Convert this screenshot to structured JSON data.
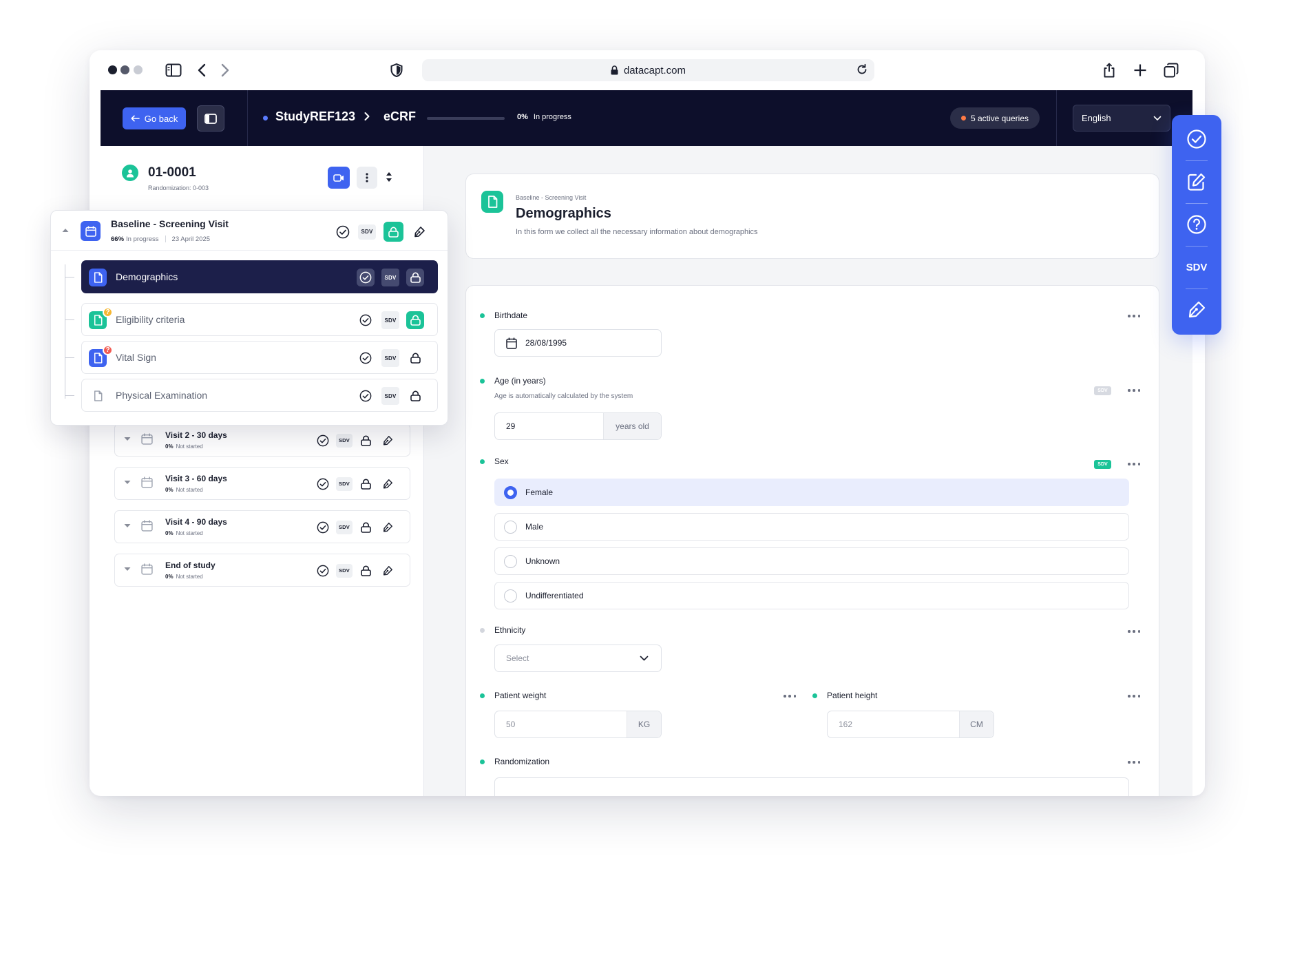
{
  "browser": {
    "url": "datacapt.com"
  },
  "topbar": {
    "back_label": "Go back",
    "study": "StudyREF123",
    "section": "eCRF",
    "progress_value": "0%",
    "progress_fraction": 0,
    "progress_status": "In progress",
    "queries": "5 active queries",
    "language": "English"
  },
  "patient": {
    "id": "01-0001",
    "randomization": "Randomization: 0-003"
  },
  "current_visit": {
    "title": "Baseline - Screening Visit",
    "progress": "66%",
    "status": "In progress",
    "date": "23 April 2025",
    "forms": [
      {
        "label": "Demographics",
        "sdv": "SDV"
      },
      {
        "label": "Eligibility criteria",
        "sdv": "SDV",
        "badge": "?"
      },
      {
        "label": "Vital Sign",
        "sdv": "SDV",
        "badge": "?"
      },
      {
        "label": "Physical Examination",
        "sdv": "SDV"
      }
    ]
  },
  "visits": [
    {
      "title": "Visit 2 - 30 days",
      "progress": "0%",
      "status": "Not started",
      "sdv": "SDV"
    },
    {
      "title": "Visit 3 - 60 days",
      "progress": "0%",
      "status": "Not started",
      "sdv": "SDV"
    },
    {
      "title": "Visit 4 - 90 days",
      "progress": "0%",
      "status": "Not started",
      "sdv": "SDV"
    },
    {
      "title": "End of study",
      "progress": "0%",
      "status": "Not started",
      "sdv": "SDV"
    }
  ],
  "form": {
    "breadcrumb": "Baseline - Screening Visit",
    "title": "Demographics",
    "description": "In this form we collect all the necessary information about demographics",
    "birthdate": {
      "label": "Birthdate",
      "value": "28/08/1995"
    },
    "age": {
      "label": "Age (in years)",
      "help": "Age is automatically calculated by the system",
      "value": "29",
      "suffix": "years old",
      "sdv": "SDV"
    },
    "sex": {
      "label": "Sex",
      "sdv": "SDV",
      "options": [
        "Female",
        "Male",
        "Unknown",
        "Undifferentiated"
      ],
      "selected": "Female"
    },
    "ethnicity": {
      "label": "Ethnicity",
      "placeholder": "Select"
    },
    "weight": {
      "label": "Patient weight",
      "placeholder": "50",
      "suffix": "KG"
    },
    "height": {
      "label": "Patient height",
      "placeholder": "162",
      "suffix": "CM"
    },
    "randomization": {
      "label": "Randomization"
    }
  },
  "sidebar": {
    "sdv_label": "SDV"
  },
  "colors": {
    "primary": "#3e63f0",
    "navy": "#0d0f2b",
    "green": "#1bc398",
    "orange": "#ff7a45",
    "yellow": "#f5b733",
    "red": "#f25c54"
  }
}
